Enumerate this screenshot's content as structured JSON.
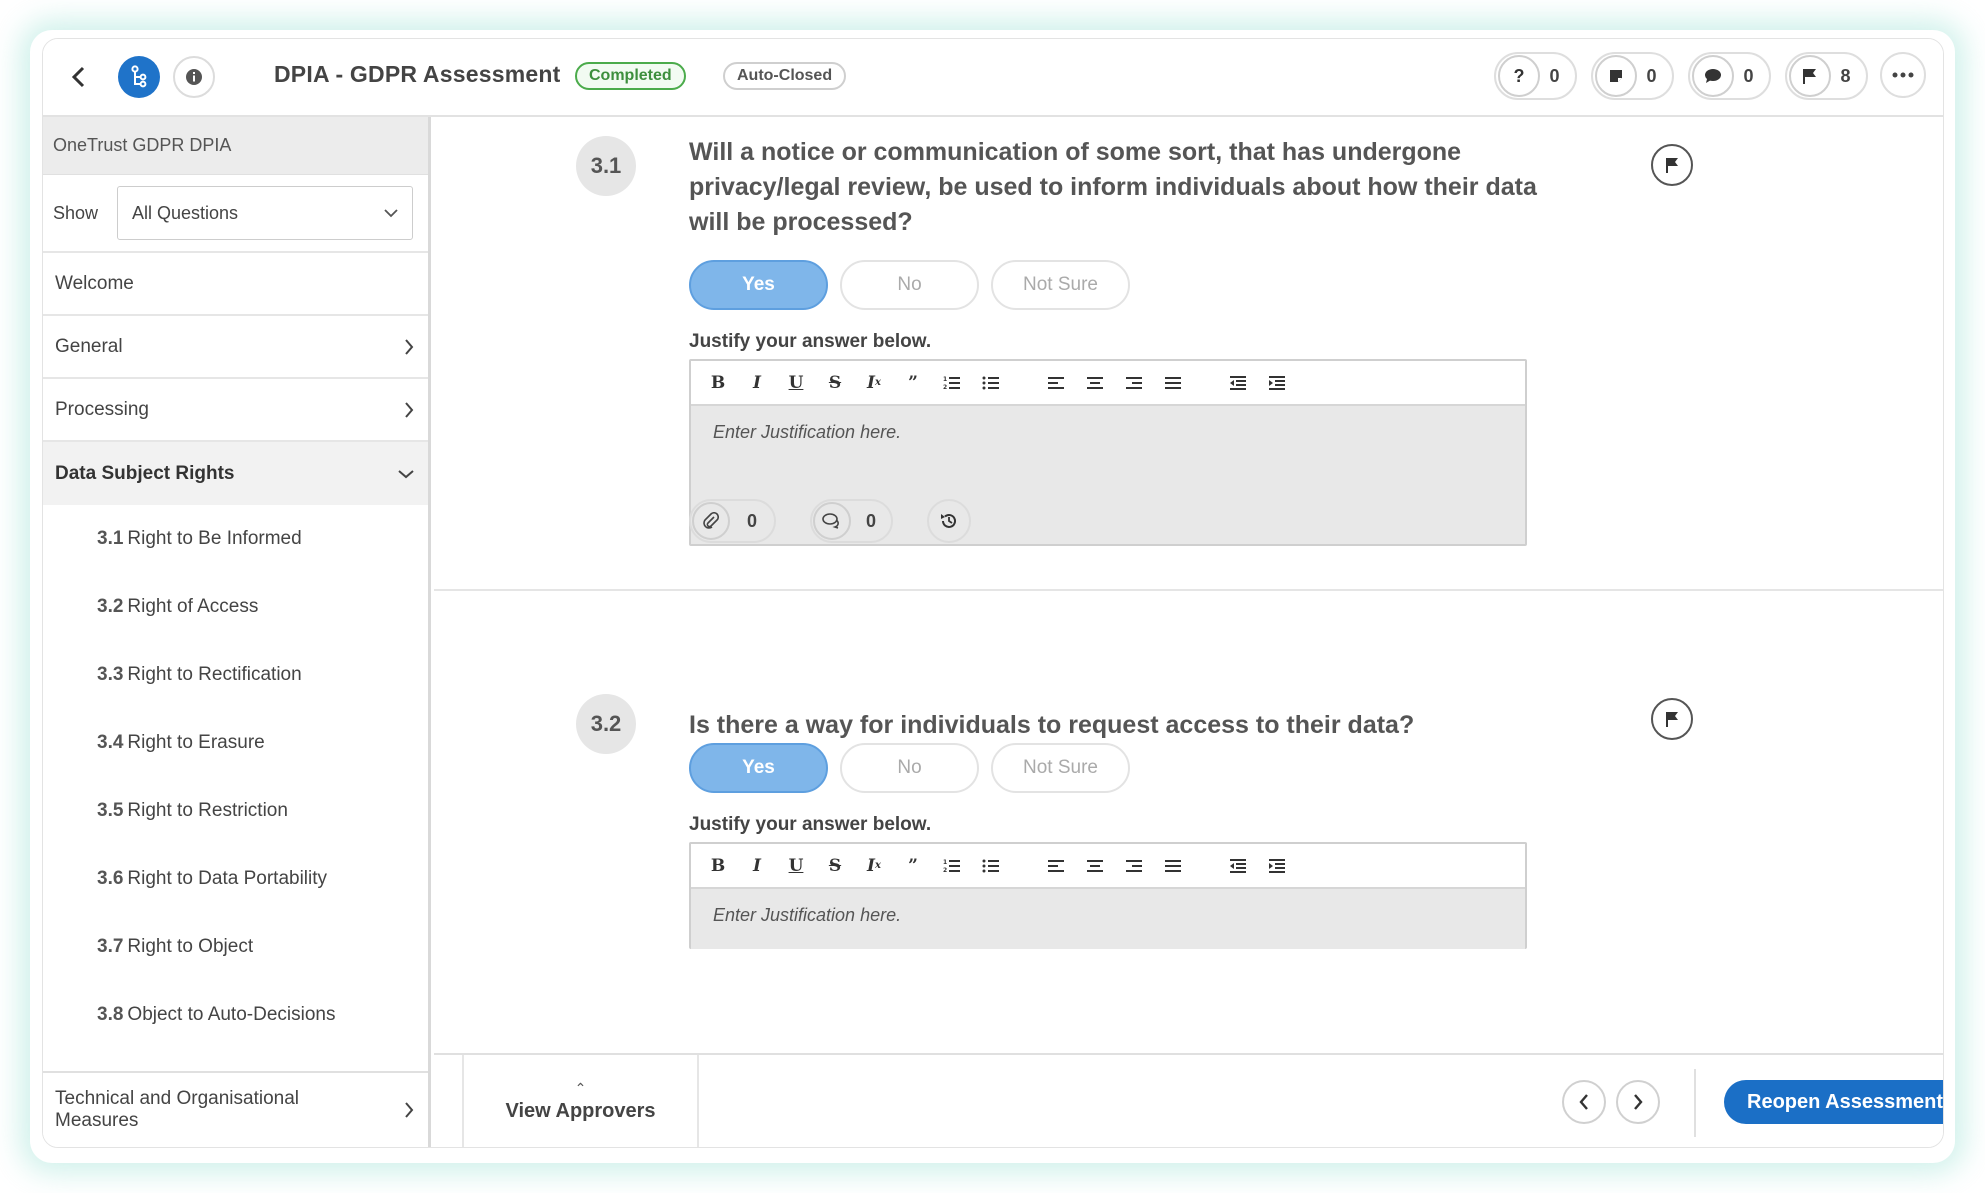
{
  "header": {
    "title": "DPIA - GDPR Assessment",
    "status_badge": "Completed",
    "closed_badge": "Auto-Closed",
    "counters": [
      {
        "icon": "question-icon",
        "count": "0"
      },
      {
        "icon": "note-icon",
        "count": "0"
      },
      {
        "icon": "comment-icon",
        "count": "0"
      },
      {
        "icon": "flag-icon",
        "count": "8"
      }
    ]
  },
  "sidebar": {
    "title": "OneTrust GDPR DPIA",
    "show_label": "Show",
    "show_value": "All Questions",
    "sections": [
      {
        "label": "Welcome"
      },
      {
        "label": "General"
      },
      {
        "label": "Processing"
      },
      {
        "label": "Data Subject Rights"
      }
    ],
    "subitems": [
      {
        "num": "3.1",
        "label": "Right to Be Informed"
      },
      {
        "num": "3.2",
        "label": "Right of Access"
      },
      {
        "num": "3.3",
        "label": "Right to Rectification"
      },
      {
        "num": "3.4",
        "label": "Right to Erasure"
      },
      {
        "num": "3.5",
        "label": "Right to Restriction"
      },
      {
        "num": "3.6",
        "label": "Right to Data Portability"
      },
      {
        "num": "3.7",
        "label": "Right to Object"
      },
      {
        "num": "3.8",
        "label": "Object to Auto-Decisions"
      }
    ],
    "last_section_line1": "Technical and Organisational",
    "last_section_line2": "Measures"
  },
  "questions": [
    {
      "num": "3.1",
      "text": "Will a notice or communication of some sort, that has undergone privacy/legal review, be used to inform individuals about how their data will be processed?",
      "answers": [
        "Yes",
        "No",
        "Not Sure"
      ],
      "selected": "Yes",
      "justify_label": "Justify your answer below.",
      "placeholder": "Enter Justification here.",
      "attachments": "0",
      "comments": "0"
    },
    {
      "num": "3.2",
      "text": "Is there a way for individuals to request access to their data?",
      "answers": [
        "Yes",
        "No",
        "Not Sure"
      ],
      "selected": "Yes",
      "justify_label": "Justify your answer below.",
      "placeholder": "Enter Justification here."
    }
  ],
  "footer": {
    "view_approvers": "View Approvers",
    "reopen": "Reopen Assessment"
  },
  "colors": {
    "brand_blue": "#1b6fc6",
    "selected_answer": "#7fb6ea",
    "completed_green": "#4bab4b"
  }
}
